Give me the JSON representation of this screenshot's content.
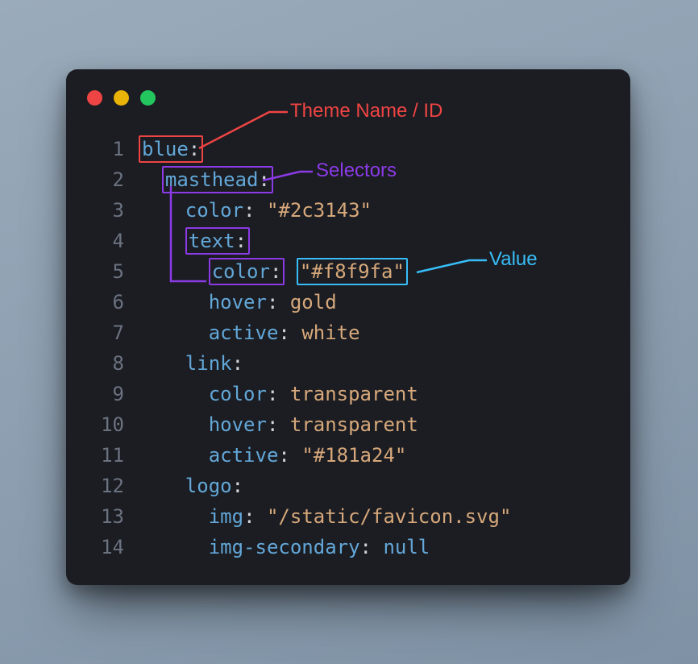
{
  "annotations": {
    "theme": "Theme Name / ID",
    "selectors": "Selectors",
    "value": "Value"
  },
  "lines": [
    {
      "n": "1",
      "indent": "",
      "key": "blue",
      "sep": ":",
      "val": "",
      "vcls": "",
      "keyBox": "hl-red"
    },
    {
      "n": "2",
      "indent": "  ",
      "key": "masthead",
      "sep": ":",
      "val": "",
      "vcls": "",
      "keyBox": "hl-purple"
    },
    {
      "n": "3",
      "indent": "    ",
      "key": "color",
      "sep": ": ",
      "val": "\"#2c3143\"",
      "vcls": "str",
      "keyBox": ""
    },
    {
      "n": "4",
      "indent": "    ",
      "key": "text",
      "sep": ":",
      "val": "",
      "vcls": "",
      "keyBox": "hl-purple"
    },
    {
      "n": "5",
      "indent": "      ",
      "key": "color",
      "sep": ":",
      "val": "\"#f8f9fa\"",
      "vcls": "str",
      "keyBox": "hl-purple",
      "valBox": "hl-cyan"
    },
    {
      "n": "6",
      "indent": "      ",
      "key": "hover",
      "sep": ": ",
      "val": "gold",
      "vcls": "id",
      "keyBox": ""
    },
    {
      "n": "7",
      "indent": "      ",
      "key": "active",
      "sep": ": ",
      "val": "white",
      "vcls": "id",
      "keyBox": ""
    },
    {
      "n": "8",
      "indent": "    ",
      "key": "link",
      "sep": ":",
      "val": "",
      "vcls": "",
      "keyBox": ""
    },
    {
      "n": "9",
      "indent": "      ",
      "key": "color",
      "sep": ": ",
      "val": "transparent",
      "vcls": "id",
      "keyBox": ""
    },
    {
      "n": "10",
      "indent": "      ",
      "key": "hover",
      "sep": ": ",
      "val": "transparent",
      "vcls": "id",
      "keyBox": ""
    },
    {
      "n": "11",
      "indent": "      ",
      "key": "active",
      "sep": ": ",
      "val": "\"#181a24\"",
      "vcls": "str",
      "keyBox": ""
    },
    {
      "n": "12",
      "indent": "    ",
      "key": "logo",
      "sep": ":",
      "val": "",
      "vcls": "",
      "keyBox": ""
    },
    {
      "n": "13",
      "indent": "      ",
      "key": "img",
      "sep": ": ",
      "val": "\"/static/favicon.svg\"",
      "vcls": "str",
      "keyBox": ""
    },
    {
      "n": "14",
      "indent": "      ",
      "key": "img-secondary",
      "sep": ": ",
      "val": "null",
      "vcls": "k",
      "keyBox": ""
    }
  ]
}
